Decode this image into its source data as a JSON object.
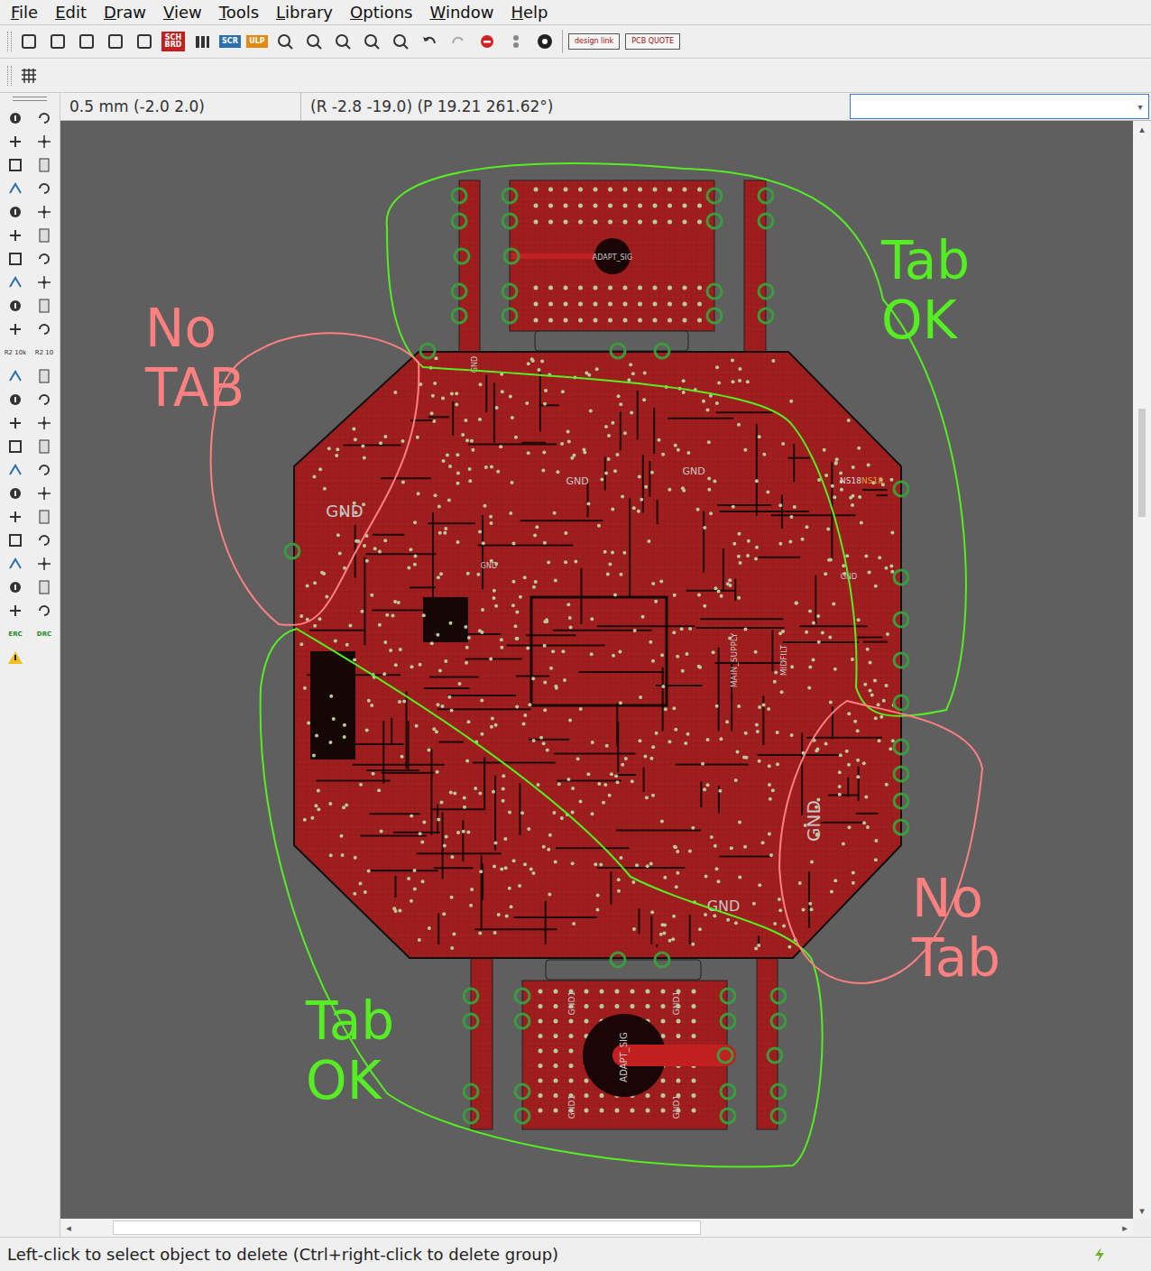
{
  "window": {
    "title": "EAGLE Board Editor"
  },
  "menu": [
    "File",
    "Edit",
    "Draw",
    "View",
    "Tools",
    "Library",
    "Options",
    "Window",
    "Help"
  ],
  "toolbar": {
    "sch_brd": "SCH BRD",
    "scr": "SCR",
    "ulp": "ULP",
    "design_link": "design link",
    "pcb_quote": "PCB QUOTE"
  },
  "left_toolbar": {
    "erc": "ERC",
    "drc": "DRC",
    "value": "R2 10k",
    "smash": "R2 10"
  },
  "grid": "0.5 mm (-2.0 2.0)",
  "coordinates": "(R -2.8 -19.0) (P 19.21 261.62°)",
  "command_input": {
    "value": ""
  },
  "board": {
    "labels": [
      "GND",
      "GND",
      "GND",
      "GND",
      "GND",
      "ADAPT_SIG",
      "MAIN_SUPPLY",
      "MIDFILT",
      "NS18",
      "NS18",
      "GND",
      "GND",
      "GND1",
      "GND1",
      "GND1",
      "GND1",
      "ADAPT_SIG",
      "GND"
    ]
  },
  "annotations": [
    {
      "lines": [
        "Tab",
        "OK"
      ],
      "color": "#55ee22"
    },
    {
      "lines": [
        "No",
        "TAB"
      ],
      "color": "#ff8080"
    },
    {
      "lines": [
        "Tab",
        "OK"
      ],
      "color": "#55ee22"
    },
    {
      "lines": [
        "No",
        "Tab"
      ],
      "color": "#ff8080"
    }
  ],
  "status_bar": "Left-click to select object to delete (Ctrl+right-click to delete group)"
}
